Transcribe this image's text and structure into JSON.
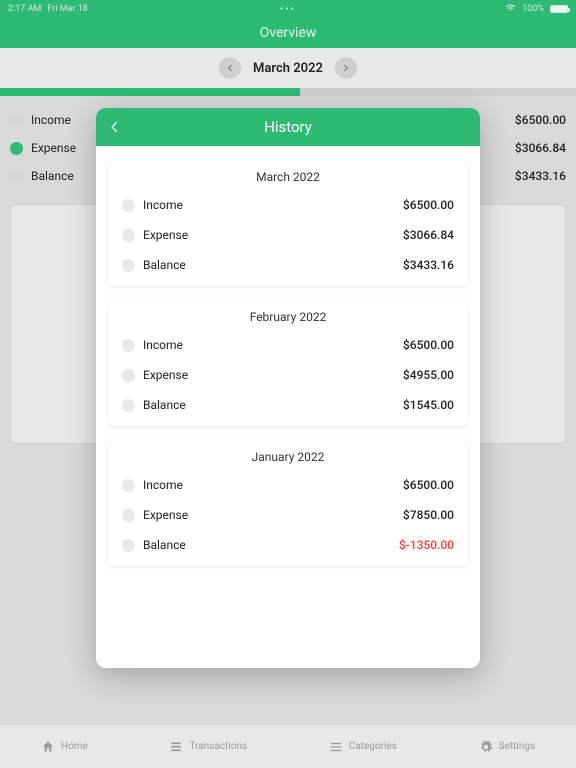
{
  "status": {
    "time": "2:17 AM",
    "date": "Fri Mar 18",
    "dots": "•••",
    "wifi": "wifi-icon",
    "battery_pct": "100%"
  },
  "header": {
    "title": "Overview"
  },
  "month_selector": {
    "label": "March  2022"
  },
  "progress": {
    "percent": 52
  },
  "summary": [
    {
      "label": "Income",
      "value": "$6500.00",
      "filled": false
    },
    {
      "label": "Expense",
      "value": "$3066.84",
      "filled": true
    },
    {
      "label": "Balance",
      "value": "$3433.16",
      "filled": false
    }
  ],
  "modal": {
    "title": "History",
    "months": [
      {
        "title": "March  2022",
        "rows": [
          {
            "label": "Income",
            "value": "$6500.00",
            "neg": false
          },
          {
            "label": "Expense",
            "value": "$3066.84",
            "neg": false
          },
          {
            "label": "Balance",
            "value": "$3433.16",
            "neg": false
          }
        ]
      },
      {
        "title": "February  2022",
        "rows": [
          {
            "label": "Income",
            "value": "$6500.00",
            "neg": false
          },
          {
            "label": "Expense",
            "value": "$4955.00",
            "neg": false
          },
          {
            "label": "Balance",
            "value": "$1545.00",
            "neg": false
          }
        ]
      },
      {
        "title": "January  2022",
        "rows": [
          {
            "label": "Income",
            "value": "$6500.00",
            "neg": false
          },
          {
            "label": "Expense",
            "value": "$7850.00",
            "neg": false
          },
          {
            "label": "Balance",
            "value": "$-1350.00",
            "neg": true
          }
        ]
      }
    ]
  },
  "nav": {
    "items": [
      {
        "label": "Home"
      },
      {
        "label": "Transactions"
      },
      {
        "label": "Categories"
      },
      {
        "label": "Settings"
      }
    ]
  }
}
